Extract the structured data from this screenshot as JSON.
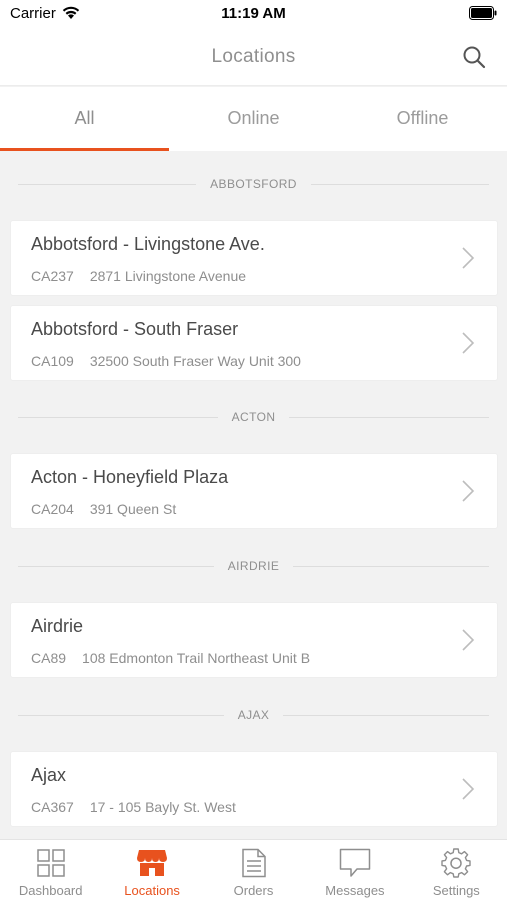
{
  "status_bar": {
    "carrier": "Carrier",
    "time": "11:19 AM"
  },
  "nav": {
    "title": "Locations"
  },
  "tabs": [
    {
      "label": "All",
      "active": true
    },
    {
      "label": "Online",
      "active": false
    },
    {
      "label": "Offline",
      "active": false
    }
  ],
  "sections": [
    {
      "header": "ABBOTSFORD",
      "items": [
        {
          "name": "Abbotsford - Livingstone Ave.",
          "code": "CA237",
          "address": "2871 Livingstone Avenue"
        },
        {
          "name": "Abbotsford - South Fraser",
          "code": "CA109",
          "address": "32500 South Fraser Way  Unit 300"
        }
      ]
    },
    {
      "header": "ACTON",
      "items": [
        {
          "name": "Acton - Honeyfield Plaza",
          "code": "CA204",
          "address": "391 Queen St"
        }
      ]
    },
    {
      "header": "AIRDRIE",
      "items": [
        {
          "name": "Airdrie",
          "code": "CA89",
          "address": "108 Edmonton Trail Northeast  Unit B"
        }
      ]
    },
    {
      "header": "AJAX",
      "items": [
        {
          "name": "Ajax",
          "code": "CA367",
          "address": "17 - 105 Bayly St. West"
        }
      ]
    }
  ],
  "tab_bar": [
    {
      "label": "Dashboard",
      "icon": "dashboard-grid-icon",
      "active": false
    },
    {
      "label": "Locations",
      "icon": "storefront-icon",
      "active": true
    },
    {
      "label": "Orders",
      "icon": "document-icon",
      "active": false
    },
    {
      "label": "Messages",
      "icon": "chat-bubble-icon",
      "active": false
    },
    {
      "label": "Settings",
      "icon": "gear-icon",
      "active": false
    }
  ],
  "colors": {
    "accent": "#e8521e",
    "text_muted": "#8e8e8e",
    "background": "#f2f2f2"
  }
}
